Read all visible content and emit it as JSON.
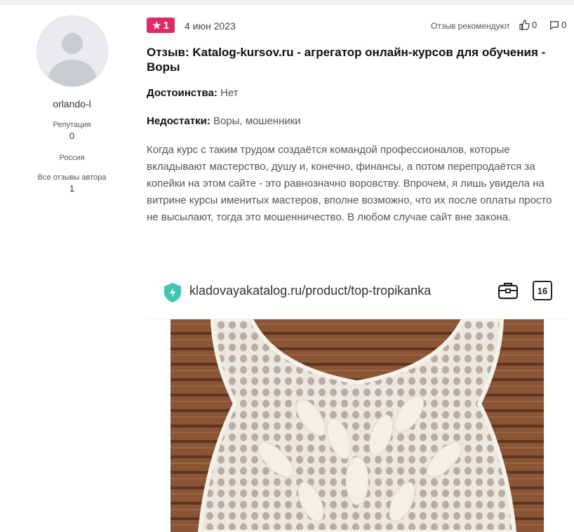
{
  "author": {
    "username": "orlando-l",
    "reputation_label": "Репутация",
    "reputation_value": "0",
    "country": "Россия",
    "reviews_label": "Все отзывы автора",
    "reviews_count": "1"
  },
  "review": {
    "rating": "1",
    "date": "4 июн 2023",
    "recommend_label": "Отзыв рекомендуют",
    "likes": "0",
    "comments": "0",
    "title": "Отзыв: Katalog-kursov.ru - агрегатор онлайн-курсов для обучения - Воры",
    "pros_label": "Достоинства:",
    "pros_value": "Нет",
    "cons_label": "Недостатки:",
    "cons_value": "Воры, мошенники",
    "text": "Когда курс с таким трудом создаётся командой профессионалов, которые вкладывают мастерство, душу и, конечно, финансы, а потом перепродаётся за копейки на этом сайте - это равнозначно воровству. Впрочем, я лишь увидела на витрине курсы именитых мастеров, вполне возможно, что их после оплаты просто не высылают, тогда это мошенничество. В любом случае сайт вне закона."
  },
  "screenshot": {
    "url": "kladovayakatalog.ru/product/top-tropikanka",
    "tab_count": "16"
  },
  "colors": {
    "rating_badge": "#e12962",
    "shield": "#41c7b0"
  }
}
